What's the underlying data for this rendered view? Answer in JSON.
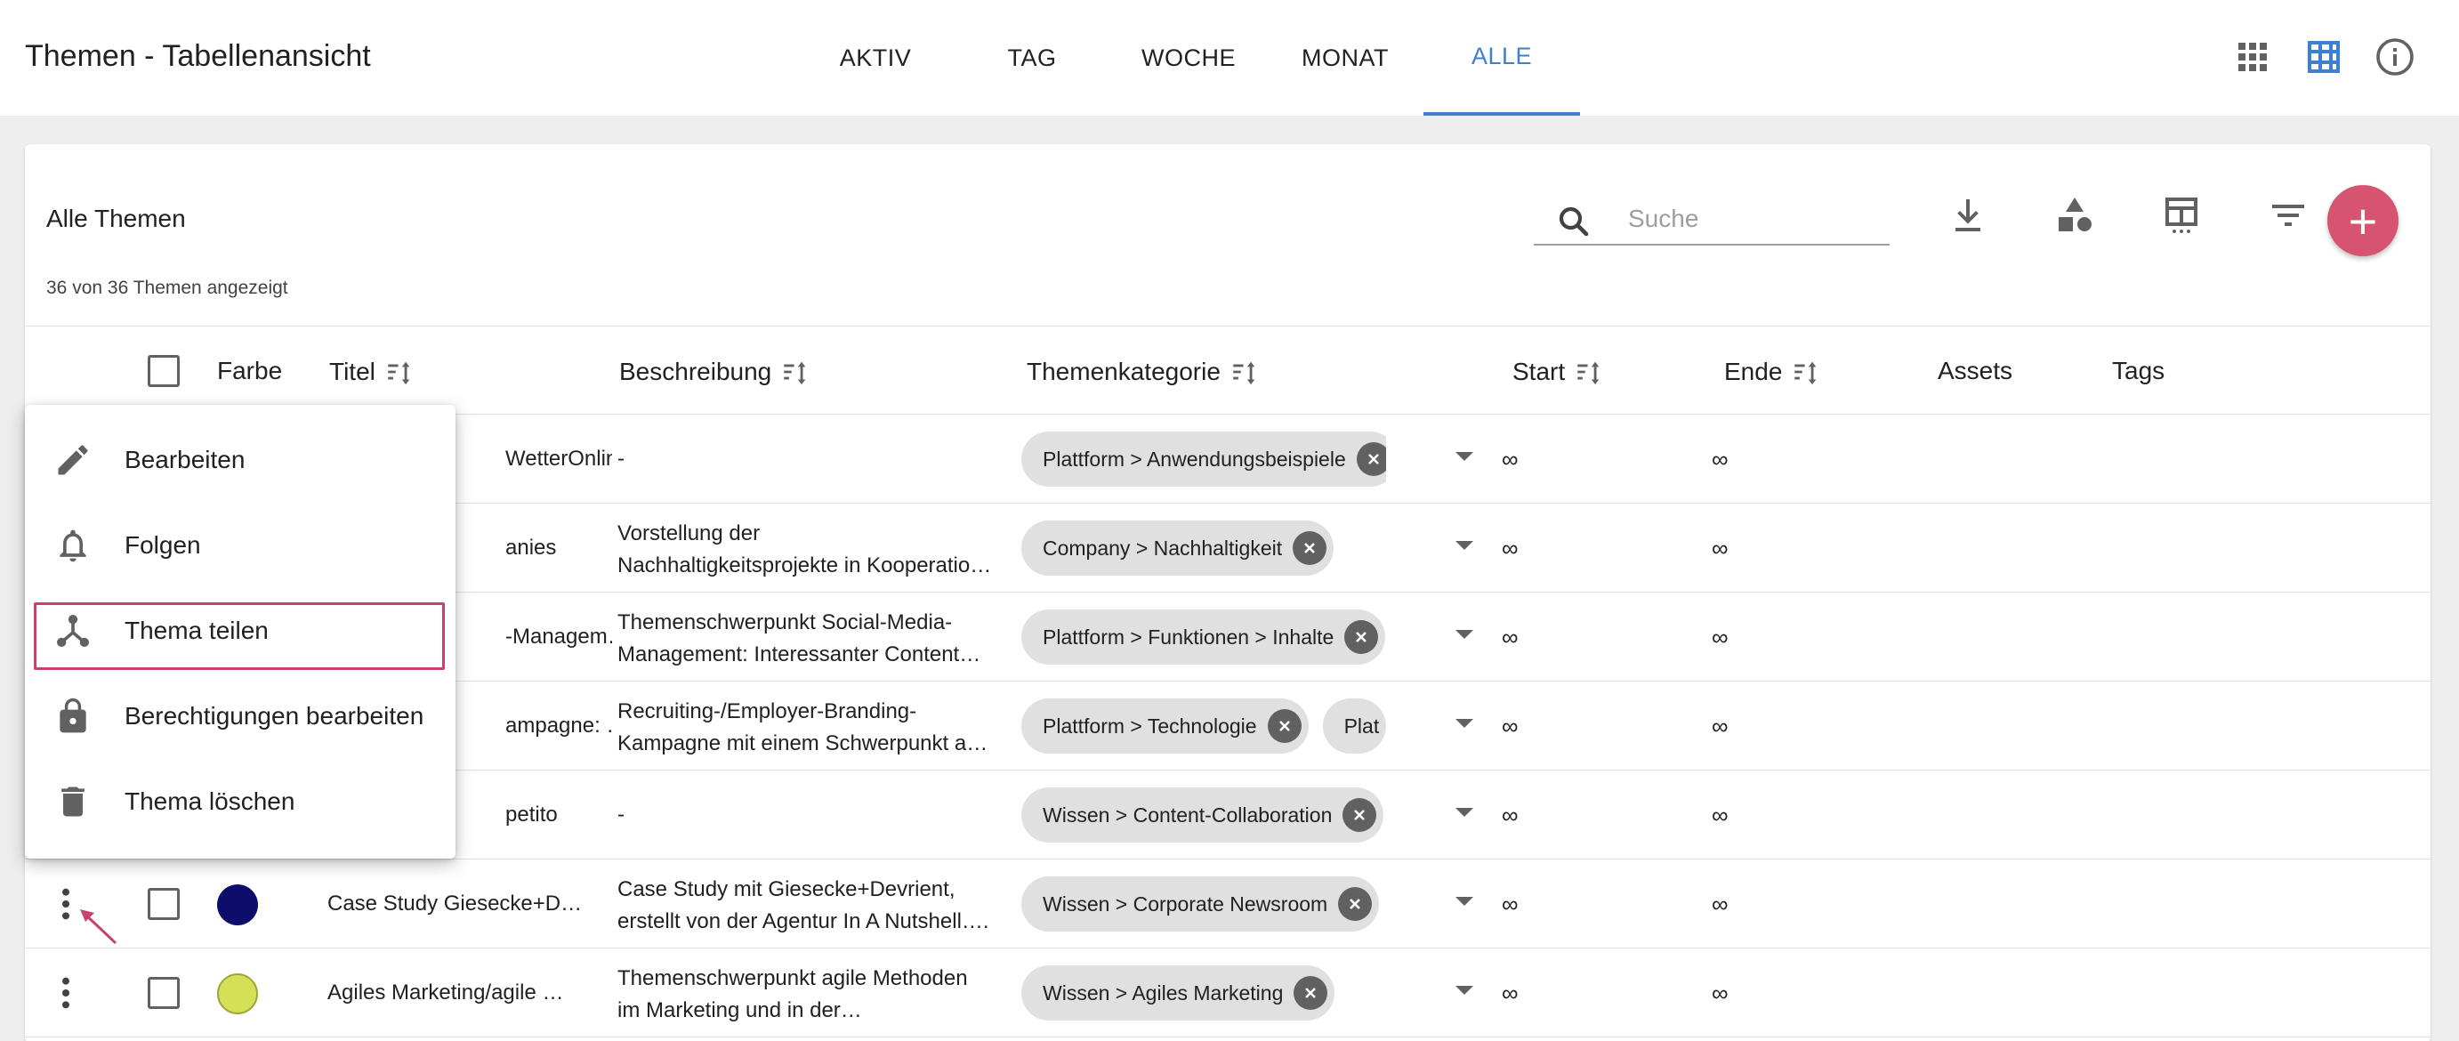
{
  "app": {
    "title": "Themen - Tabellenansicht"
  },
  "tabs": [
    {
      "label": "AKTIV",
      "active": false
    },
    {
      "label": "TAG",
      "active": false
    },
    {
      "label": "WOCHE",
      "active": false
    },
    {
      "label": "MONAT",
      "active": false
    },
    {
      "label": "ALLE",
      "active": true
    }
  ],
  "top_icons": [
    "grid-view-icon",
    "table-view-icon",
    "info-icon"
  ],
  "card": {
    "title": "Alle Themen",
    "count_text": "36 von 36 Themen angezeigt",
    "search_placeholder": "Suche",
    "tool_icons": [
      "download-icon",
      "shapes-icon",
      "table-columns-icon",
      "filter-icon"
    ],
    "add_label": "+"
  },
  "columns": {
    "color": "Farbe",
    "title": "Titel",
    "description": "Beschreibung",
    "category": "Themenkategorie",
    "start": "Start",
    "end": "Ende",
    "assets": "Assets",
    "tags": "Tags"
  },
  "rows": [
    {
      "title": "WetterOnline",
      "desc": [
        "-"
      ],
      "chips": [
        "Plattform > Anwendungsbeispiele"
      ],
      "start": "∞",
      "end": "∞",
      "color": ""
    },
    {
      "title": "anies",
      "desc": [
        "Vorstellung der",
        "Nachhaltigkeitsprojekte in Kooperatio…"
      ],
      "chips": [
        "Company > Nachhaltigkeit"
      ],
      "start": "∞",
      "end": "∞",
      "color": ""
    },
    {
      "title": "-Managem…",
      "desc": [
        "Themenschwerpunkt Social-Media-",
        "Management: Interessanter Content…"
      ],
      "chips": [
        "Plattform > Funktionen > Inhalte"
      ],
      "start": "∞",
      "end": "∞",
      "color": ""
    },
    {
      "title": "ampagne: …",
      "desc": [
        "Recruiting-/Employer-Branding-",
        "Kampagne mit einem Schwerpunkt a…"
      ],
      "chips": [
        "Plattform > Technologie",
        "Plat"
      ],
      "start": "∞",
      "end": "∞",
      "color": ""
    },
    {
      "title": "petito",
      "desc": [
        "-"
      ],
      "chips": [
        "Wissen > Content-Collaboration"
      ],
      "start": "∞",
      "end": "∞",
      "color": ""
    },
    {
      "title": "Case Study Giesecke+D…",
      "desc": [
        "Case Study mit Giesecke+Devrient,",
        "erstellt von der Agentur In A Nutshell…."
      ],
      "chips": [
        "Wissen > Corporate Newsroom"
      ],
      "start": "∞",
      "end": "∞",
      "color": "#0d0d6b"
    },
    {
      "title": "Agiles Marketing/agile …",
      "desc": [
        "Themenschwerpunkt agile Methoden",
        "im Marketing und in der…"
      ],
      "chips": [
        "Wissen > Agiles Marketing"
      ],
      "start": "∞",
      "end": "∞",
      "color": "#d4e157"
    }
  ],
  "menu": {
    "items": [
      {
        "label": "Bearbeiten",
        "icon": "pencil-icon"
      },
      {
        "label": "Folgen",
        "icon": "bell-icon"
      },
      {
        "label": "Thema teilen",
        "icon": "share-icon",
        "highlighted": true
      },
      {
        "label": "Berechtigungen bearbeiten",
        "icon": "lock-icon"
      },
      {
        "label": "Thema löschen",
        "icon": "trash-icon"
      }
    ]
  },
  "colors": {
    "accent": "#3f7fd0",
    "fab": "#d6546f",
    "highlight": "#c8426e"
  }
}
